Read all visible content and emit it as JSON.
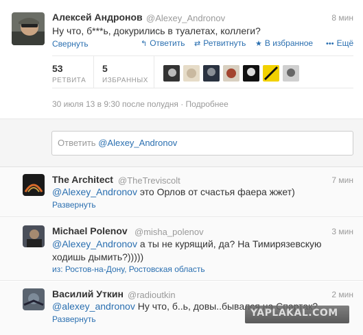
{
  "main_tweet": {
    "author_name": "Алексей Андронов",
    "author_handle": "@Alexey_Andronov",
    "time": "8 мин",
    "text": "Ну что, б***ь, докурились в туалетах, коллеги?",
    "collapse_label": "Свернуть",
    "actions": {
      "reply": "Ответить",
      "retweet": "Ретвитнуть",
      "favorite": "В избранное",
      "more": "Ещё"
    },
    "stats": {
      "retweets_count": "53",
      "retweets_label": "РЕТВИТА",
      "favorites_count": "5",
      "favorites_label": "ИЗБРАННЫХ"
    },
    "timestamp": "30 июля 13 в 9:30 после полудня",
    "details_label": "Подробнее"
  },
  "reply_box": {
    "prefix": "Ответить",
    "mention": "@Alexey_Andronov"
  },
  "replies": [
    {
      "author_name": "The Architect",
      "author_handle": "@TheTreviscolt",
      "time": "7 мин",
      "mention": "@Alexey_Andronov",
      "text": " это Орлов от счастья фаера жжет)",
      "footer": "Развернуть"
    },
    {
      "author_name": "Michael Polenov",
      "author_handle": "@misha_polenov",
      "time": "3 мин",
      "mention": "@Alexey_Andronov",
      "text_line1": " а ты не курящий, да? На Тимирязевскую",
      "text_line2": "ходишь дымить?)))))",
      "location": "из: Ростов-на-Дону, Ростовская область"
    },
    {
      "author_name": "Василий Уткин",
      "author_handle": "@radioutkin",
      "time": "2 мин",
      "mention": "@alexey_andronov",
      "text": " Ну что, б..ь, довы..бывался на Спартак?",
      "footer": "Развернуть"
    }
  ],
  "watermark": "YAPLAKAL.COM",
  "colors": {
    "link": "#2a6fb0",
    "muted": "#999999",
    "text": "#333333",
    "panel_bg": "#f5f5f5"
  }
}
